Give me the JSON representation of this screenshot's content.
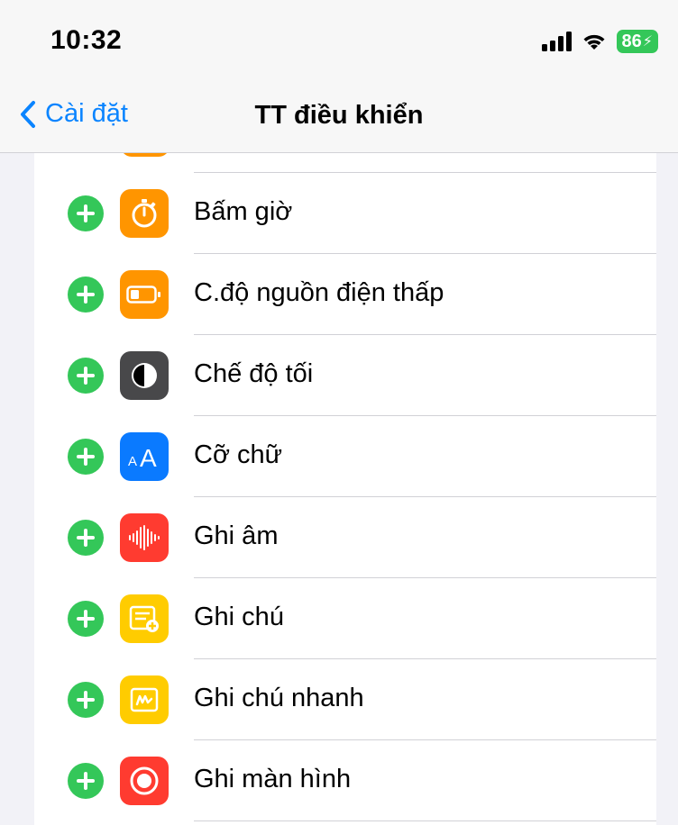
{
  "status_bar": {
    "time": "10:32",
    "battery": "86"
  },
  "nav": {
    "back_label": "Cài đặt",
    "title": "TT điều khiển"
  },
  "colors": {
    "accent": "#0a84ff",
    "add_green": "#34c759"
  },
  "items": [
    {
      "label": "Bấm giờ",
      "icon": "stopwatch-icon",
      "color": "#ff9500"
    },
    {
      "label": "C.độ nguồn điện thấp",
      "icon": "low-power-battery-icon",
      "color": "#ff9500"
    },
    {
      "label": "Chế độ tối",
      "icon": "dark-mode-icon",
      "color": "#48484a"
    },
    {
      "label": "Cỡ chữ",
      "icon": "text-size-icon",
      "color": "#0a7aff"
    },
    {
      "label": "Ghi âm",
      "icon": "voice-memo-waveform-icon",
      "color": "#ff3b30"
    },
    {
      "label": "Ghi chú",
      "icon": "notes-add-icon",
      "color": "#ffcc00"
    },
    {
      "label": "Ghi chú nhanh",
      "icon": "quick-note-icon",
      "color": "#ffcc00"
    },
    {
      "label": "Ghi màn hình",
      "icon": "screen-record-icon",
      "color": "#ff3b30"
    }
  ]
}
